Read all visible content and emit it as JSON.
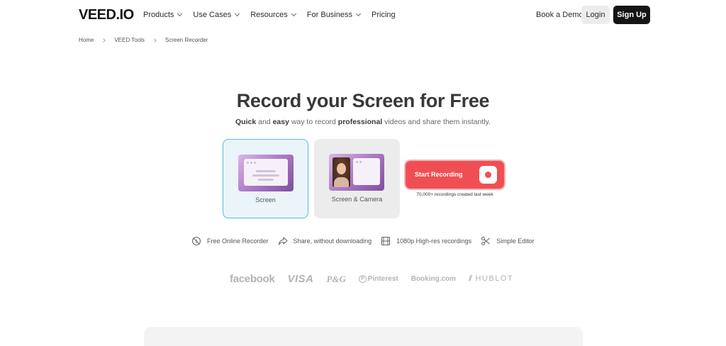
{
  "nav": {
    "logo": "VEED.IO",
    "links": [
      "Products",
      "Use Cases",
      "Resources",
      "For Business",
      "Pricing"
    ],
    "book_demo": "Book a Demo",
    "login": "Login",
    "signup": "Sign Up"
  },
  "breadcrumb": [
    "Home",
    "VEED Tools",
    "Screen Recorder"
  ],
  "hero": {
    "title": "Record your Screen for Free",
    "subtitle_parts": [
      "Quick",
      " and ",
      "easy",
      " way to record ",
      "professional",
      " videos and share them instantly."
    ]
  },
  "modes": [
    {
      "label": "Screen",
      "selected": true
    },
    {
      "label": "Screen & Camera",
      "selected": false
    }
  ],
  "record": {
    "label": "Start Recording",
    "note": "70,000+ recordings created last week",
    "color": "#ef4f53"
  },
  "features": [
    {
      "icon": "free-icon",
      "label": "Free Online Recorder"
    },
    {
      "icon": "share-icon",
      "label": "Share, without downloading"
    },
    {
      "icon": "film-icon",
      "label": "1080p High-res recordings"
    },
    {
      "icon": "scissors-icon",
      "label": "Simple Editor"
    }
  ],
  "logos": [
    "facebook",
    "VISA",
    "P&G",
    "Pinterest",
    "Booking.com",
    "HUBLOT"
  ],
  "colors": {
    "accent_selected_border": "#54bfd8",
    "signup_bg": "#151515"
  }
}
